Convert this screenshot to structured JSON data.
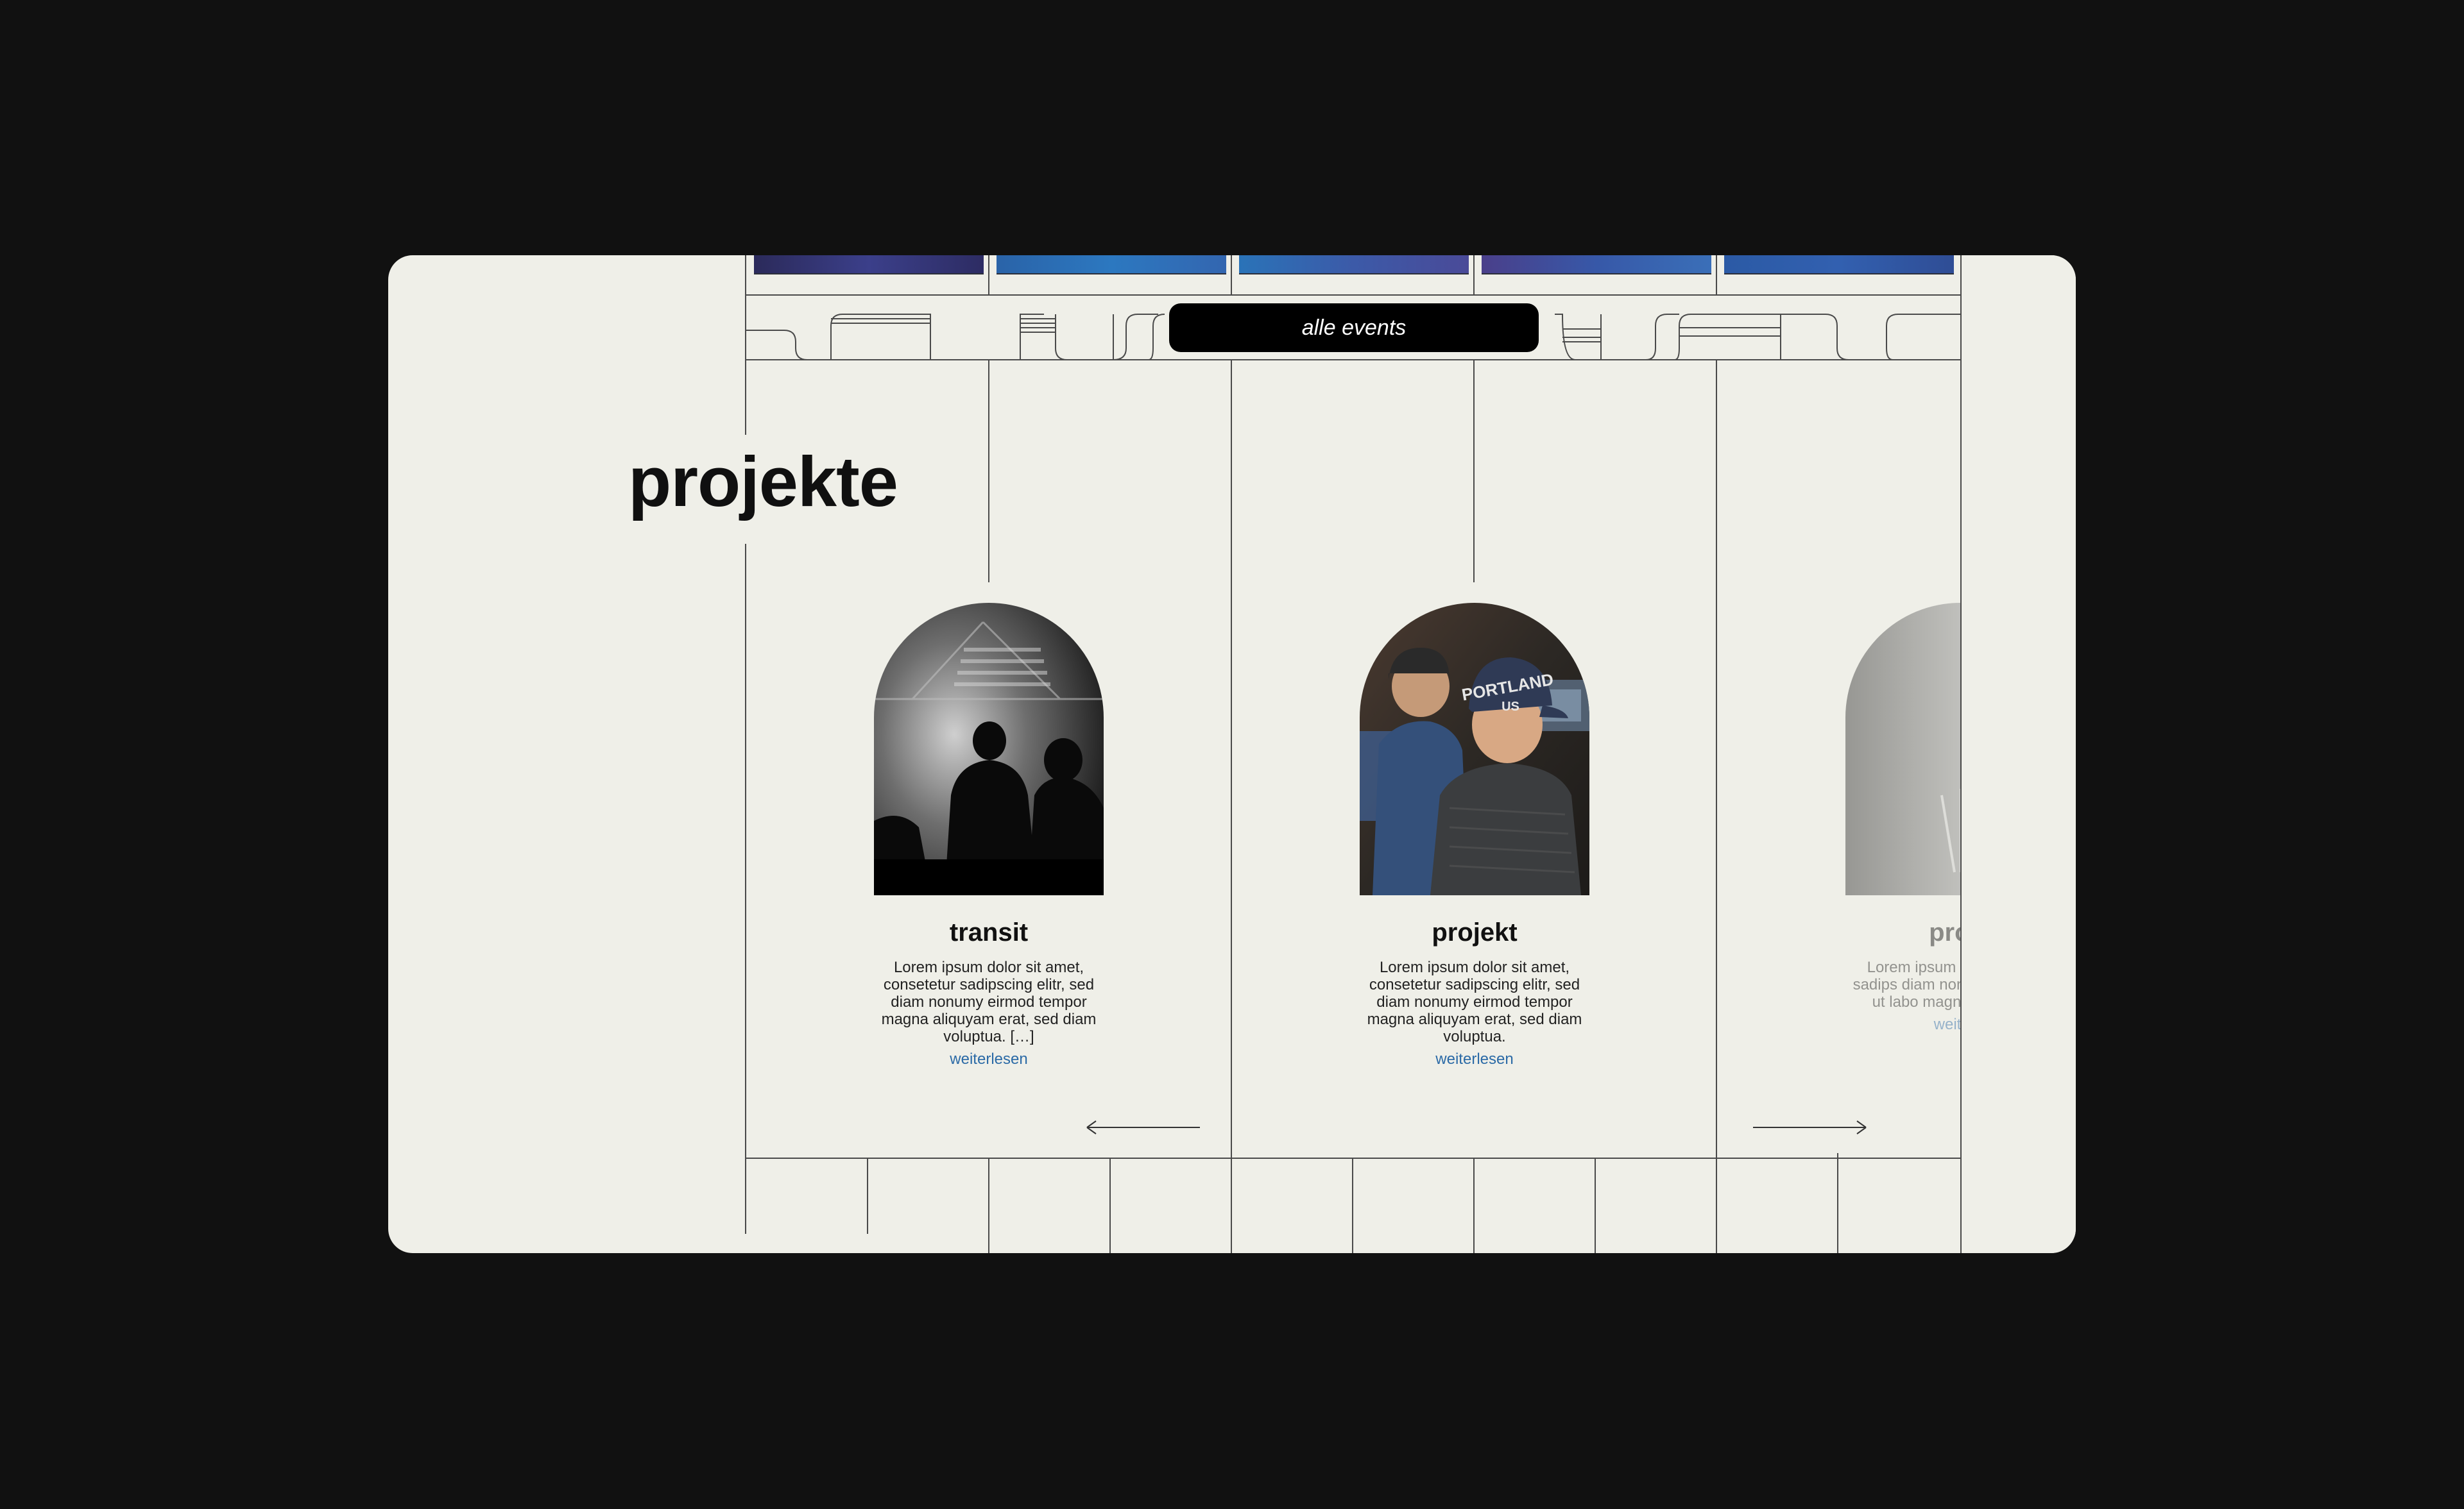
{
  "section": {
    "heading": "projekte"
  },
  "events": {
    "button_label": "alle events"
  },
  "projects": [
    {
      "title": "transit",
      "text": "Lorem ipsum dolor sit amet, consetetur sadipscing elitr, sed diam nonumy eirmod tempor magna aliquyam erat, sed diam voluptua. […]",
      "link": "weiterlesen"
    },
    {
      "title": "projekt",
      "text": "Lorem ipsum dolor sit amet, consetetur sadipscing elitr, sed diam nonumy eirmod tempor magna aliquyam erat, sed diam voluptua.",
      "link": "weiterlesen"
    },
    {
      "title": "proje",
      "text": "Lorem ipsum do consetetur sadips diam nonumy ei invidunt ut labo magna aliquyam e",
      "link": "weiterle"
    }
  ],
  "colors": {
    "page_bg": "#111111",
    "card_bg": "#efefe8",
    "line": "#4a4a4a",
    "button_bg": "#000000",
    "link": "#2b6aa6"
  },
  "icons": {
    "prev": "arrow-left-icon",
    "next": "arrow-right-icon"
  }
}
